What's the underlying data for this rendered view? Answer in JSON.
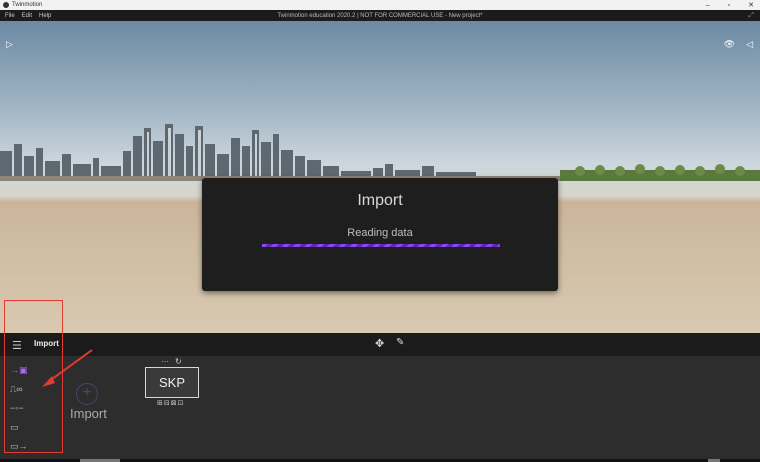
{
  "window": {
    "app_title": "Twinmotion",
    "buttons": [
      "–",
      "▫",
      "✕"
    ]
  },
  "menu": {
    "items": [
      "File",
      "Edit",
      "Help"
    ],
    "project_title": "Twinmotion education 2020.2 | NOT FOR COMMERCIAL USE - New project*"
  },
  "viewport": {
    "left_arrow": "▷",
    "eye_icon": "👁",
    "right_arrow": "◁"
  },
  "dialog": {
    "title": "Import",
    "status": "Reading data"
  },
  "toolbar": {
    "title": "Import",
    "hamburger": "☰",
    "move": "✥",
    "pen": "✎"
  },
  "panel": {
    "side_tools": [
      "→▣",
      "⎍∞",
      "−◦−",
      "▭",
      "▭→"
    ],
    "import_label": "Import",
    "import_plus": "+",
    "skp": {
      "label": "SKP",
      "dots": "···",
      "refresh": "↻",
      "icons": "⊞⊟⊠⊡"
    }
  },
  "colors": {
    "accent": "#8e44ff",
    "highlight": "#e23b2f",
    "panel": "#2d2d2d",
    "toolbar": "#1b1b1b"
  }
}
